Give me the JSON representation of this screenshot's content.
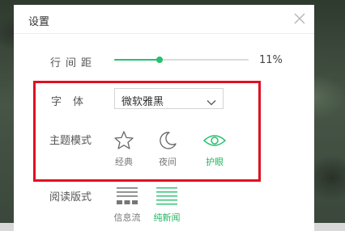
{
  "dialog": {
    "title": "设置",
    "close_icon": "close-icon"
  },
  "line_spacing": {
    "label": "行间距",
    "value_text": "11%",
    "level_fraction": 0.34
  },
  "font": {
    "label": "字体",
    "selected": "微软雅黑",
    "dropdown_icon": "chevron-down-icon"
  },
  "theme": {
    "label": "主题模式",
    "options": [
      {
        "label": "经典",
        "icon": "star-icon",
        "active": false
      },
      {
        "label": "夜间",
        "icon": "moon-icon",
        "active": false
      },
      {
        "label": "护眼",
        "icon": "eye-icon",
        "active": true
      }
    ]
  },
  "reading_layout": {
    "label": "阅读版式",
    "options": [
      {
        "label": "信息流",
        "icon": "feed-layout-icon",
        "active": false
      },
      {
        "label": "纯新闻",
        "icon": "text-layout-icon",
        "active": true
      }
    ]
  },
  "colors": {
    "accent": "#28c06e",
    "highlight_border": "#e01020",
    "text": "#555555"
  }
}
